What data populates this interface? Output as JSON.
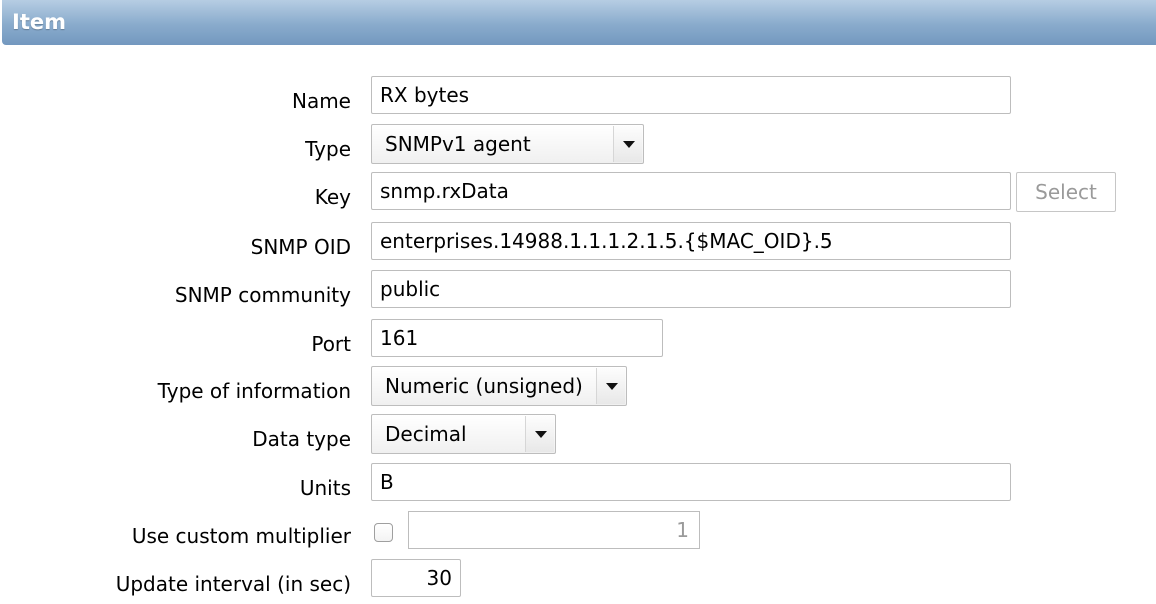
{
  "header": {
    "title": "Item"
  },
  "form": {
    "name": {
      "label": "Name",
      "value": "RX bytes"
    },
    "type": {
      "label": "Type",
      "selected": "SNMPv1 agent"
    },
    "key": {
      "label": "Key",
      "value": "snmp.rxData",
      "select_button": "Select"
    },
    "snmp_oid": {
      "label": "SNMP OID",
      "value": "enterprises.14988.1.1.1.2.1.5.{$MAC_OID}.5"
    },
    "snmp_community": {
      "label": "SNMP community",
      "value": "public"
    },
    "port": {
      "label": "Port",
      "value": "161"
    },
    "type_of_information": {
      "label": "Type of information",
      "selected": "Numeric (unsigned)"
    },
    "data_type": {
      "label": "Data type",
      "selected": "Decimal"
    },
    "units": {
      "label": "Units",
      "value": "B"
    },
    "custom_multiplier": {
      "label": "Use custom multiplier",
      "checked": false,
      "value": "1"
    },
    "update_interval": {
      "label": "Update interval (in sec)",
      "value": "30"
    }
  }
}
